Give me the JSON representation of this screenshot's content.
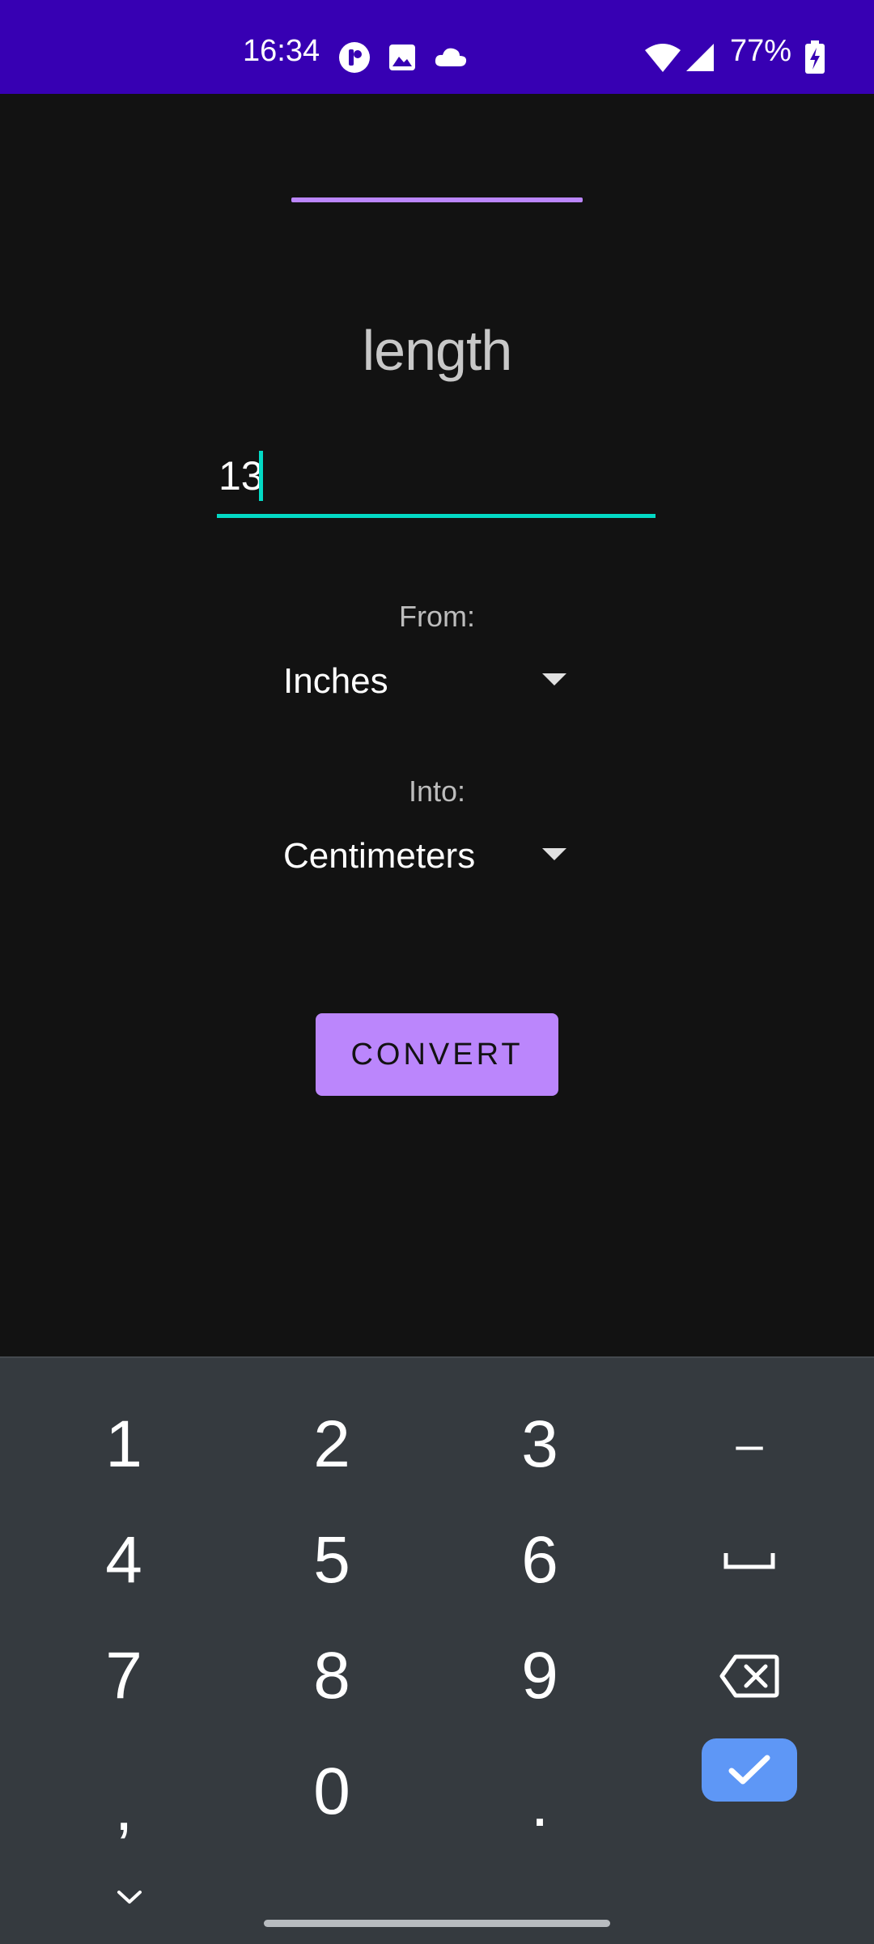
{
  "status_bar": {
    "time": "16:34",
    "battery": "77%",
    "icons": [
      "app-notification-icon",
      "gallery-icon",
      "cloud-icon",
      "wifi-icon",
      "signal-icon",
      "battery-charging-icon"
    ]
  },
  "screen": {
    "title": "length",
    "input_value": "13",
    "from_label": "From:",
    "from_value": "Inches",
    "into_label": "Into:",
    "into_value": "Centimeters",
    "convert_label": "CONVERT"
  },
  "keyboard": {
    "keys": [
      "1",
      "2",
      "3",
      "–",
      "4",
      "5",
      "6",
      "␣",
      "7",
      "8",
      "9",
      "⌫",
      ",",
      "0",
      ".",
      "✓"
    ],
    "row1": [
      "1",
      "2",
      "3",
      "–"
    ],
    "row2": [
      "4",
      "5",
      "6"
    ],
    "row3": [
      "7",
      "8",
      "9"
    ],
    "row4": [
      ",",
      "0",
      "."
    ]
  },
  "colors": {
    "status_bar": "#3700b3",
    "accent_primary": "#bb86fc",
    "accent_secondary": "#03dac5",
    "background": "#121212",
    "keyboard_bg": "#353a3f",
    "done_key": "#5e97f6"
  }
}
